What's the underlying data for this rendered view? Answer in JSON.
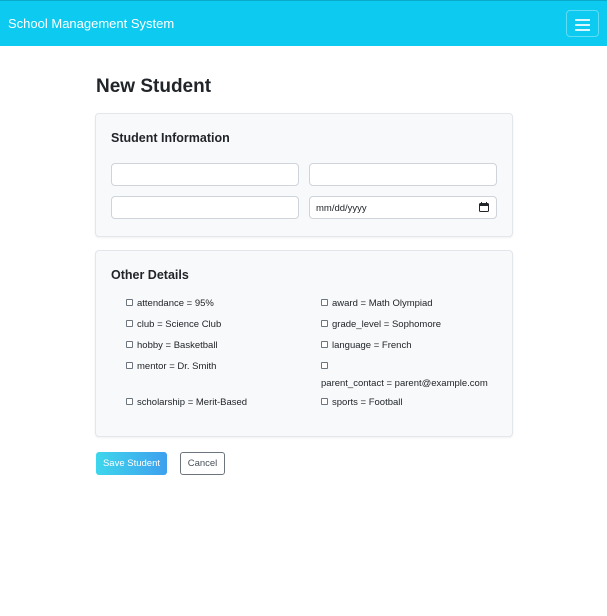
{
  "navbar": {
    "brand": "School Management System",
    "toggler_icon": "hamburger-menu-icon"
  },
  "page": {
    "title": "New Student"
  },
  "student_info": {
    "title": "Student Information",
    "fields": [
      {
        "value": "",
        "placeholder": ""
      },
      {
        "value": "",
        "placeholder": ""
      },
      {
        "value": "",
        "placeholder": ""
      }
    ],
    "date": {
      "placeholder": "mm/dd/yyyy",
      "icon": "calendar-icon"
    }
  },
  "other_details": {
    "title": "Other Details",
    "checkbox_icon": "checkbox-icon",
    "items": [
      {
        "label": "attendance = 95%",
        "checked": false
      },
      {
        "label": "award = Math Olympiad",
        "checked": false
      },
      {
        "label": "club = Science Club",
        "checked": false
      },
      {
        "label": "grade_level = Sophomore",
        "checked": false
      },
      {
        "label": "hobby = Basketball",
        "checked": false
      },
      {
        "label": "language = French",
        "checked": false
      },
      {
        "label": "mentor = Dr. Smith",
        "checked": false
      },
      {
        "label": "parent_contact = parent@example.com",
        "checked": false
      },
      {
        "label": "scholarship = Merit-Based",
        "checked": false
      },
      {
        "label": "sports = Football",
        "checked": false
      }
    ]
  },
  "actions": {
    "save_label": "Save Student",
    "cancel_label": "Cancel"
  },
  "colors": {
    "navbar": "#0dcaf0",
    "card_bg": "#f8f9fa",
    "save_gradient_start": "#3ed6ec",
    "save_gradient_end": "#3ea0ee"
  }
}
